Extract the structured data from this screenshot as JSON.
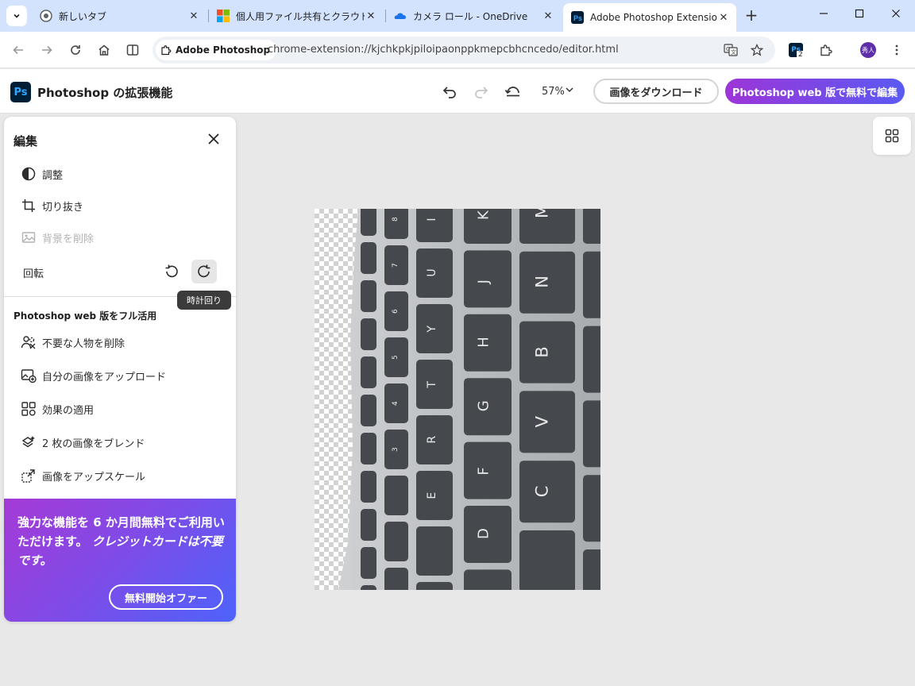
{
  "browser": {
    "tabs": [
      {
        "title": "新しいタブ",
        "icon": "chrome-icon",
        "active": false
      },
      {
        "title": "個人用ファイル共有とクラウド ス",
        "icon": "microsoft-icon",
        "active": false
      },
      {
        "title": "カメラ ロール - OneDrive",
        "icon": "onedrive-icon",
        "active": false
      },
      {
        "title": "Adobe Photoshop Extension",
        "icon": "photoshop-icon",
        "active": true
      }
    ],
    "site_chip": "Adobe Photoshop",
    "url": "chrome-extension://kjchkpkjpiloipaonppkmepcbhcncedo/editor.html",
    "extension_badge": "2",
    "avatar_text": "秀人"
  },
  "app": {
    "logo": "Ps",
    "title": "Photoshop の拡張機能",
    "zoom": "57%",
    "download_label": "画像をダウンロード",
    "edit_web_label": "Photoshop web 版で無料で編集"
  },
  "panel": {
    "title": "編集",
    "items": [
      {
        "label": "調整",
        "icon": "adjust-icon",
        "disabled": false
      },
      {
        "label": "切り抜き",
        "icon": "crop-icon",
        "disabled": false
      },
      {
        "label": "背景を削除",
        "icon": "remove-background-icon",
        "disabled": true
      }
    ],
    "rotate_label": "回転",
    "tooltip": "時計回り",
    "section_title": "Photoshop web 版をフル活用",
    "features": [
      {
        "label": "不要な人物を削除",
        "icon": "remove-people-icon"
      },
      {
        "label": "自分の画像をアップロード",
        "icon": "upload-image-icon"
      },
      {
        "label": "効果の適用",
        "icon": "effects-icon"
      },
      {
        "label": "2 枚の画像をブレンド",
        "icon": "blend-icon"
      },
      {
        "label": "画像をアップスケール",
        "icon": "upscale-icon"
      }
    ],
    "promo_text_1": "強力な機能を 6 か月間無料でご利用いただけます。",
    "promo_text_2": "クレジットカードは不要です。",
    "promo_button": "無料開始オファー"
  },
  "canvas": {
    "keyboard_keys": [
      "M",
      "K",
      "N",
      "J",
      "B",
      "H",
      "V",
      "G",
      "C",
      "F",
      "D",
      "U",
      "Y",
      "T",
      "R",
      "E",
      "I",
      "8",
      "7",
      "6",
      "5",
      "4",
      "3"
    ]
  },
  "colors": {
    "brand_gradient_start": "#9d35d8",
    "brand_gradient_end": "#4d63fb",
    "tab_strip": "#d3e3fd"
  }
}
